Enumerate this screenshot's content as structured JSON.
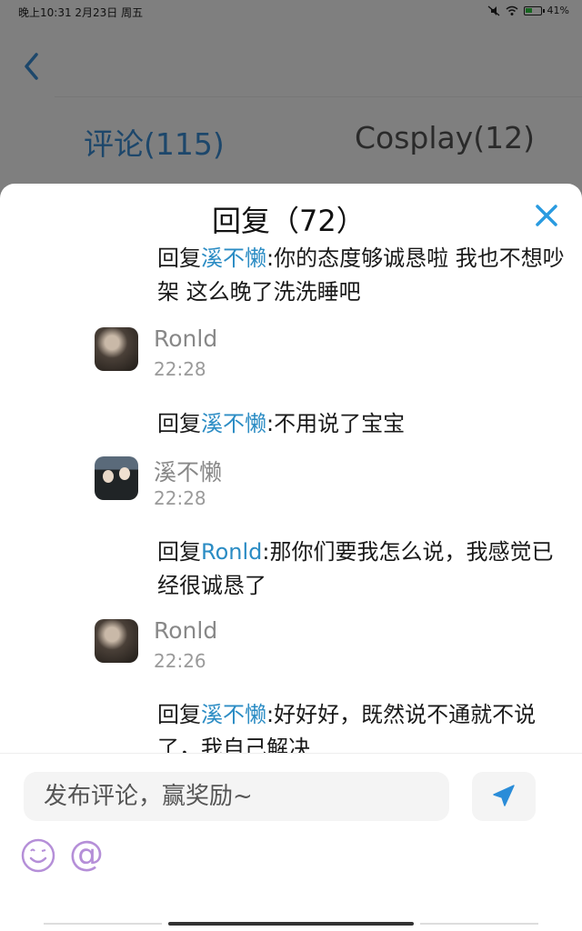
{
  "status_bar": {
    "time": "晚上10:31 2月23日 周五",
    "battery": "41%"
  },
  "tabs": [
    {
      "label": "评论(115)",
      "active": true
    },
    {
      "label": "Cosplay(12)",
      "active": false
    }
  ],
  "sheet": {
    "title": "回复（72）"
  },
  "replies": [
    {
      "prefix": "回复",
      "mention": "溪不懒",
      "text": ":你的态度够诚恳啦 我也不想吵架 这么晚了洗洗睡吧"
    },
    {
      "username": "Ronld",
      "time": "22:28"
    },
    {
      "prefix": "回复",
      "mention": "溪不懒",
      "text": ":不用说了宝宝"
    },
    {
      "username": "溪不懒",
      "time": "22:28"
    },
    {
      "prefix": "回复",
      "mention": "Ronld",
      "text": ":那你们要我怎么说，我感觉已经很诚恳了"
    },
    {
      "username": "Ronld",
      "time": "22:26"
    },
    {
      "prefix": "回复",
      "mention": "溪不懒",
      "text": ":好好好，既然说不通就不说了，我自己解决"
    }
  ],
  "input": {
    "placeholder": "发布评论，赢奖励~"
  },
  "colors": {
    "accent": "#3a8fd6",
    "mention": "#2b8cc4",
    "send_icon": "#2a8cd8",
    "emoji": "#b58fd8"
  },
  "icons": {
    "back": "chevron-left-icon",
    "close": "close-icon",
    "send": "send-icon",
    "emoji": "emoji-icon",
    "mention": "at-icon"
  },
  "bottom_bar": {
    "at_symbol": "@"
  }
}
